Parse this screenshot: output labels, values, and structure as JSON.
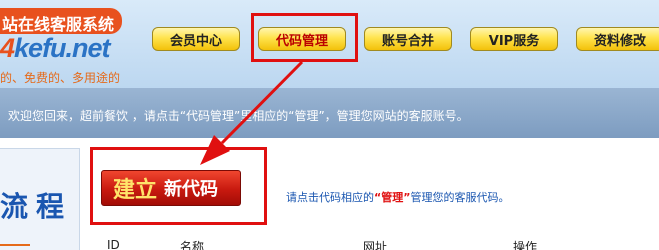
{
  "logo": {
    "cn": "站在线客服系统",
    "en_num": "4",
    "en_rest": "kefu.net",
    "tagline": "的、免费的、多用途的"
  },
  "nav": {
    "member": "会员中心",
    "code": "代码管理",
    "merge": "账号合并",
    "vip": "VIP服务",
    "profile": "资料修改"
  },
  "welcome": {
    "text": "欢迎您回来，超前餐饮 ，请点击“代码管理”里相应的“管理”，管理您网站的客服账号。"
  },
  "side": {
    "title": "流程"
  },
  "create": {
    "main": "建立",
    "rest": "新代码"
  },
  "hint": {
    "before": "请点击代码相应的",
    "em": "“管理”",
    "after": "管理您的客服代码。"
  },
  "table": {
    "headers": [
      "ID",
      "名称",
      "网址",
      "操作"
    ]
  },
  "colors": {
    "accent_red": "#e01010",
    "nav_yellow": "#ffe34d",
    "welcome_blue": "#8aa8c9",
    "link_blue": "#1a56b0",
    "brand_orange": "#e8511e"
  },
  "icons": {
    "annotation": "arrow-icon"
  }
}
